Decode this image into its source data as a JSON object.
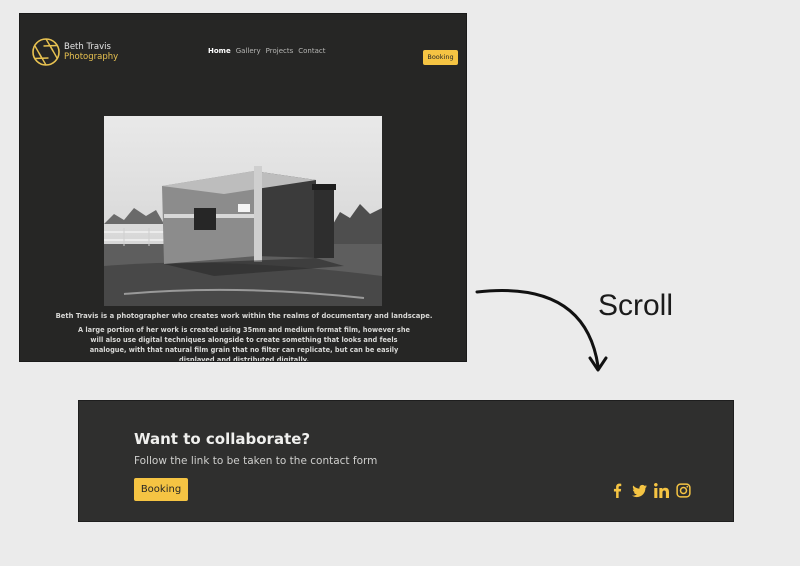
{
  "header": {
    "logo_line1": "Beth Travis",
    "logo_line2": "Photography",
    "nav": [
      "Home",
      "Gallery",
      "Projects",
      "Contact"
    ],
    "booking_label": "Booking"
  },
  "intro": {
    "p1": "Beth Travis is a photographer who creates work within the realms of documentary and landscape.",
    "p2": "A large portion of her work is created using 35mm and medium format film, however she will also use digital techniques alongside to create something that looks and feels analogue, with that natural film grain that no filter can replicate, but can be easily displayed and distributed digitally."
  },
  "annotation": {
    "scroll_label": "Scroll"
  },
  "footer": {
    "title": "Want to collaborate?",
    "text": "Follow the link to be taken to the contact form",
    "booking_label": "Booking",
    "social_icons": [
      "facebook-icon",
      "twitter-icon",
      "linkedin-icon",
      "instagram-icon"
    ]
  },
  "colors": {
    "accent": "#f5c443",
    "dark_bg": "#262625",
    "footer_bg": "#2f2f2e"
  }
}
